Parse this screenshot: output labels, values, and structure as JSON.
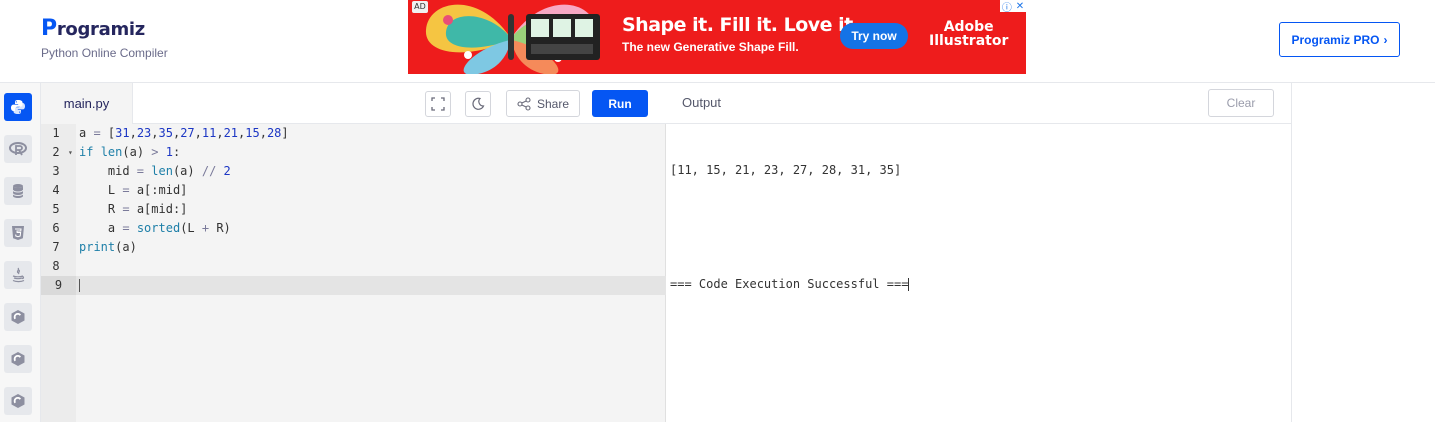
{
  "brand": {
    "logo_first": "P",
    "logo_rest": "rogramiz",
    "subtitle": "Python Online Compiler"
  },
  "ad": {
    "badge": "AD",
    "headline": "Shape it. Fill it. Love it.",
    "subline": "The new Generative Shape Fill.",
    "cta": "Try now",
    "brand_line1": "Adobe",
    "brand_line2": "Illustrator",
    "colors": {
      "background": "#ee1c1c",
      "cta": "#1473e6"
    }
  },
  "header": {
    "pro_button": "Programiz PRO",
    "pro_chevron": "›"
  },
  "sidebar": {
    "languages": [
      {
        "name": "python-icon",
        "active": true
      },
      {
        "name": "r-icon",
        "active": false
      },
      {
        "name": "sql-icon",
        "active": false
      },
      {
        "name": "html-icon",
        "active": false
      },
      {
        "name": "java-icon",
        "active": false
      },
      {
        "name": "c-icon",
        "active": false
      },
      {
        "name": "cpp-icon",
        "active": false
      },
      {
        "name": "csharp-icon",
        "active": false
      }
    ]
  },
  "editor": {
    "file_tab": "main.py",
    "share_label": "Share",
    "run_label": "Run",
    "current_line": 9,
    "lines": [
      "a = [31,23,35,27,11,21,15,28]",
      "if len(a) > 1:",
      "    mid = len(a) // 2",
      "    L = a[:mid]",
      "    R = a[mid:]",
      "    a = sorted(L + R)",
      "print(a)",
      "",
      ""
    ]
  },
  "output": {
    "title": "Output",
    "clear_label": "Clear",
    "lines": [
      "[11, 15, 21, 23, 27, 28, 31, 35]",
      "",
      "=== Code Execution Successful ==="
    ]
  },
  "colors": {
    "accent": "#0556f3",
    "brand_text": "#25265e"
  }
}
